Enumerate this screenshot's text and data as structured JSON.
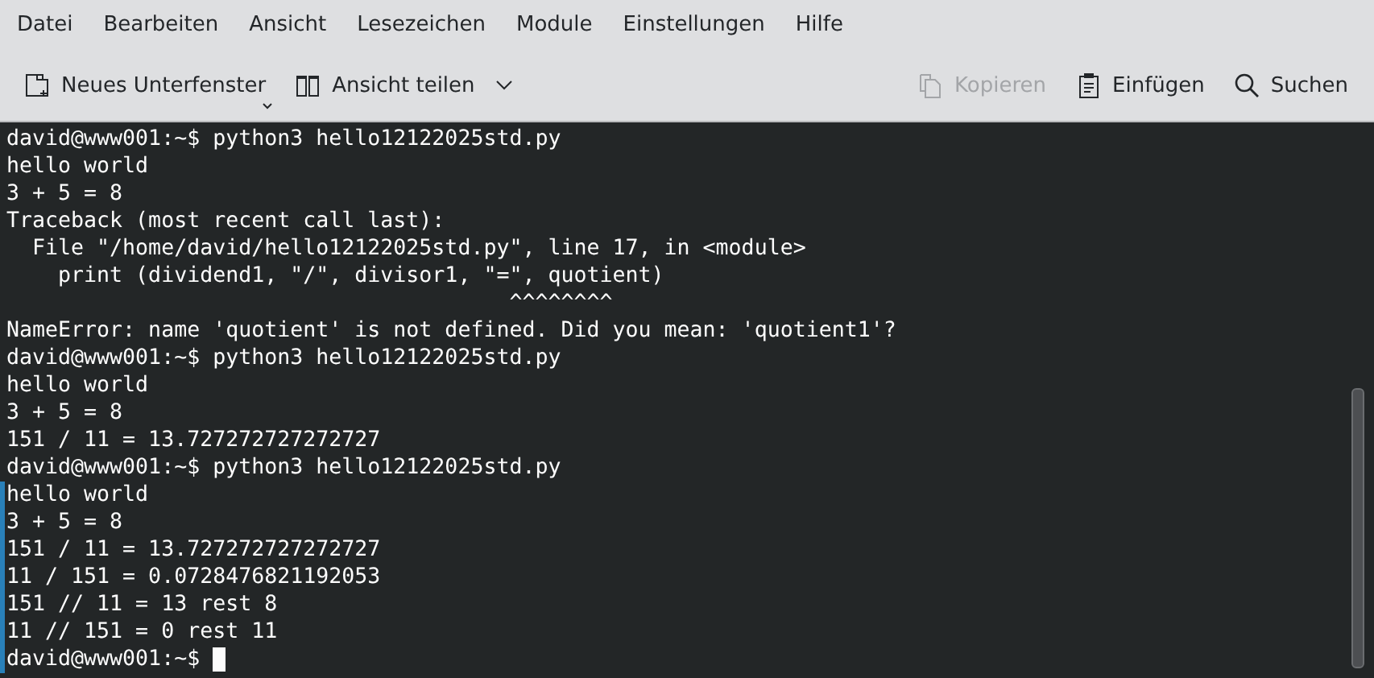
{
  "menu": [
    "Datei",
    "Bearbeiten",
    "Ansicht",
    "Lesezeichen",
    "Module",
    "Einstellungen",
    "Hilfe"
  ],
  "toolbar": {
    "left": [
      {
        "kind": "new-tab",
        "label": "Neues Unterfenster",
        "disabled": false
      },
      {
        "kind": "split",
        "label": "Ansicht teilen",
        "disabled": false
      }
    ],
    "right": [
      {
        "kind": "copy",
        "label": "Kopieren",
        "disabled": true
      },
      {
        "kind": "paste",
        "label": "Einfügen",
        "disabled": false
      },
      {
        "kind": "search",
        "label": "Suchen",
        "disabled": false
      }
    ]
  },
  "terminal": {
    "cursor": true,
    "lines": [
      {
        "text": "david@www001:~$ python3 hello12122025std.py",
        "marked": false
      },
      {
        "text": "hello world",
        "marked": false
      },
      {
        "text": "3 + 5 = 8",
        "marked": false
      },
      {
        "text": "Traceback (most recent call last):",
        "marked": false
      },
      {
        "text": "  File \"/home/david/hello12122025std.py\", line 17, in <module>",
        "marked": false
      },
      {
        "text": "    print (dividend1, \"/\", divisor1, \"=\", quotient)",
        "marked": false
      },
      {
        "text": "                                       ^^^^^^^^",
        "marked": false
      },
      {
        "text": "NameError: name 'quotient' is not defined. Did you mean: 'quotient1'?",
        "marked": false
      },
      {
        "text": "david@www001:~$ python3 hello12122025std.py",
        "marked": false
      },
      {
        "text": "hello world",
        "marked": false
      },
      {
        "text": "3 + 5 = 8",
        "marked": false
      },
      {
        "text": "151 / 11 = 13.727272727272727",
        "marked": false
      },
      {
        "text": "david@www001:~$ python3 hello12122025std.py",
        "marked": false
      },
      {
        "text": "hello world",
        "marked": true
      },
      {
        "text": "3 + 5 = 8",
        "marked": true
      },
      {
        "text": "151 / 11 = 13.727272727272727",
        "marked": true
      },
      {
        "text": "11 / 151 = 0.0728476821192053",
        "marked": true
      },
      {
        "text": "151 // 11 = 13 rest 8",
        "marked": true
      },
      {
        "text": "11 // 151 = 0 rest 11",
        "marked": true
      },
      {
        "text": "david@www001:~$",
        "marked": true
      }
    ]
  }
}
